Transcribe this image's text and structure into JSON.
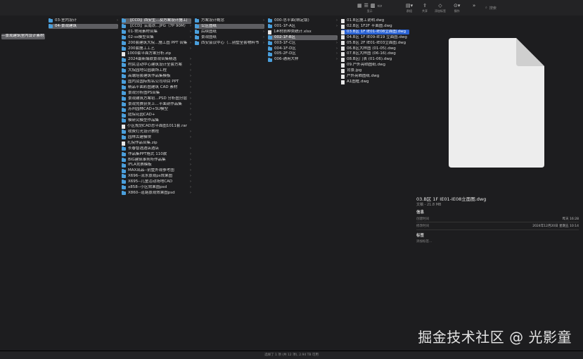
{
  "toolbar": {
    "groups": [
      {
        "key": "display",
        "label": "显示"
      },
      {
        "key": "group",
        "label": "群组"
      },
      {
        "key": "share",
        "label": "共享"
      },
      {
        "key": "tags",
        "label": "添加标签"
      },
      {
        "key": "action",
        "label": "操作"
      }
    ],
    "search_placeholder": "搜索"
  },
  "columns": [
    {
      "items": [
        {
          "label": "—景观建筑室内设计素材",
          "sel": "gray"
        }
      ]
    },
    {
      "items": [
        {
          "label": "03-室内设计",
          "type": "folder"
        },
        {
          "label": "04-景观建筑",
          "type": "folder",
          "sel": "gray"
        }
      ]
    },
    {
      "items": [
        {
          "label": "【CCD】西安生...及方案设计施工图",
          "type": "folder",
          "sel": "gray"
        },
        {
          "label": "【CCD】云南玖...JPG（7P 90M）",
          "type": "folder"
        },
        {
          "label": "01-常用素材合集",
          "type": "folder"
        },
        {
          "label": "02-ss模型合集",
          "type": "folder"
        },
        {
          "label": "200套建筑大院...施工图 PPT 合集",
          "type": "folder"
        },
        {
          "label": "200套施工工艺",
          "type": "folder"
        },
        {
          "label": "1000套平面方案分析.zip",
          "type": "file"
        },
        {
          "label": "2024最新爆款景观合集精选",
          "type": "folder"
        },
        {
          "label": "村民活动中心建筑设计全套方案",
          "type": "folder"
        },
        {
          "label": "大院园地公园装饰工程",
          "type": "folder"
        },
        {
          "label": "高端培套建筑作品集模板",
          "type": "folder"
        },
        {
          "label": "国内及国际知名公司项目 PPT",
          "type": "folder"
        },
        {
          "label": "精品平面彩图建筑 CAD 素材",
          "type": "folder"
        },
        {
          "label": "景观分析图PS合集",
          "type": "folder"
        },
        {
          "label": "景观建筑方案初...PSD 分析图分层",
          "type": "folder"
        },
        {
          "label": "景观竞赛获奖上...平面剖作品集",
          "type": "folder"
        },
        {
          "label": "苏州园林CAD+SU模型",
          "type": "folder"
        },
        {
          "label": "庭院花园CAD+",
          "type": "folder"
        },
        {
          "label": "模研究模型作品集",
          "type": "folder"
        },
        {
          "label": "小区规划CAD总平面图1011套.rar",
          "type": "file"
        },
        {
          "label": "收费灯光设计教程",
          "type": "folder"
        },
        {
          "label": "园林古建模块",
          "type": "folder"
        },
        {
          "label": "扎院作品合集.zip",
          "type": "file"
        },
        {
          "label": "长春智选酒店酒店",
          "type": "folder"
        },
        {
          "label": "作品集PPT格式 110款",
          "type": "folder"
        },
        {
          "label": "BIG建筑事务所作品集",
          "type": "folder"
        },
        {
          "label": "IFLA竞赛模板",
          "type": "folder"
        },
        {
          "label": "MAX出品--别墅外观参考图",
          "type": "folder"
        },
        {
          "label": "X696--流水景观ps效果图",
          "type": "folder"
        },
        {
          "label": "X695--儿童活动场地CAD",
          "type": "folder"
        },
        {
          "label": "x858--小区效果图psd",
          "type": "folder"
        },
        {
          "label": "X860--道路景观效果图psd",
          "type": "folder"
        }
      ]
    },
    {
      "items": [
        {
          "label": "方案设计概念",
          "type": "folder"
        },
        {
          "label": "公区图纸",
          "type": "folder",
          "sel": "gray"
        },
        {
          "label": "后续图纸",
          "type": "folder"
        },
        {
          "label": "景观图纸",
          "type": "folder"
        },
        {
          "label": "西安会议中心（...别墅全套物料书",
          "type": "folder"
        }
      ]
    },
    {
      "items": [
        {
          "label": "000-总平面(绑定版)",
          "type": "folder"
        },
        {
          "label": "001-1F-A区",
          "type": "folder"
        },
        {
          "label": "1#材质种类统计.xlsx",
          "type": "file"
        },
        {
          "label": "002-1F-B区",
          "type": "folder",
          "sel": "gray"
        },
        {
          "label": "003-1F-C区",
          "type": "folder"
        },
        {
          "label": "004-1F-D区",
          "type": "folder"
        },
        {
          "label": "005-2F-D区",
          "type": "folder"
        },
        {
          "label": "006-通用大样",
          "type": "folder"
        }
      ]
    },
    {
      "items": [
        {
          "label": "01.B区施工说明.dwg",
          "type": "file"
        },
        {
          "label": "02.B区 1F2F 平面图.dwg",
          "type": "file"
        },
        {
          "label": "03.B区 1F IE01-IE08立面图.dwg",
          "type": "file",
          "sel": "blue"
        },
        {
          "label": "04.B区 1F IE09-IE19 立面图.dwg",
          "type": "file"
        },
        {
          "label": "05.B区 2F IE01-IE03立面图.dwg",
          "type": "file"
        },
        {
          "label": "06.B区大样图 (01-05).dwg",
          "type": "file"
        },
        {
          "label": "07.B区大样图 (06-16).dwg",
          "type": "file"
        },
        {
          "label": "08.B区门表 (01-06).dwg",
          "type": "file"
        },
        {
          "label": "09.户外亮晒图纸.dwg",
          "type": "file"
        },
        {
          "label": "背景.jpg",
          "type": "file"
        },
        {
          "label": "户外亮晒图纸.dwg",
          "type": "file"
        },
        {
          "label": "A1图框.dwg",
          "type": "file"
        }
      ]
    }
  ],
  "preview": {
    "filename": "03.B区 1F IE01-IE08立面图.dwg",
    "kind_size": "文稿 - 21.8 MB",
    "info_heading": "信息",
    "created_label": "创建时间",
    "created_value": "昨天 16:28",
    "modified_label": "修改时间",
    "modified_value": "2024年12月20日 星期五 10:14",
    "tags_heading": "标签",
    "tags_placeholder": "添加标签..."
  },
  "status_text": "选择了 1 项 (共 12 项), 2.94 TB 可用",
  "watermark": "掘金技术社区 @ 光影童"
}
